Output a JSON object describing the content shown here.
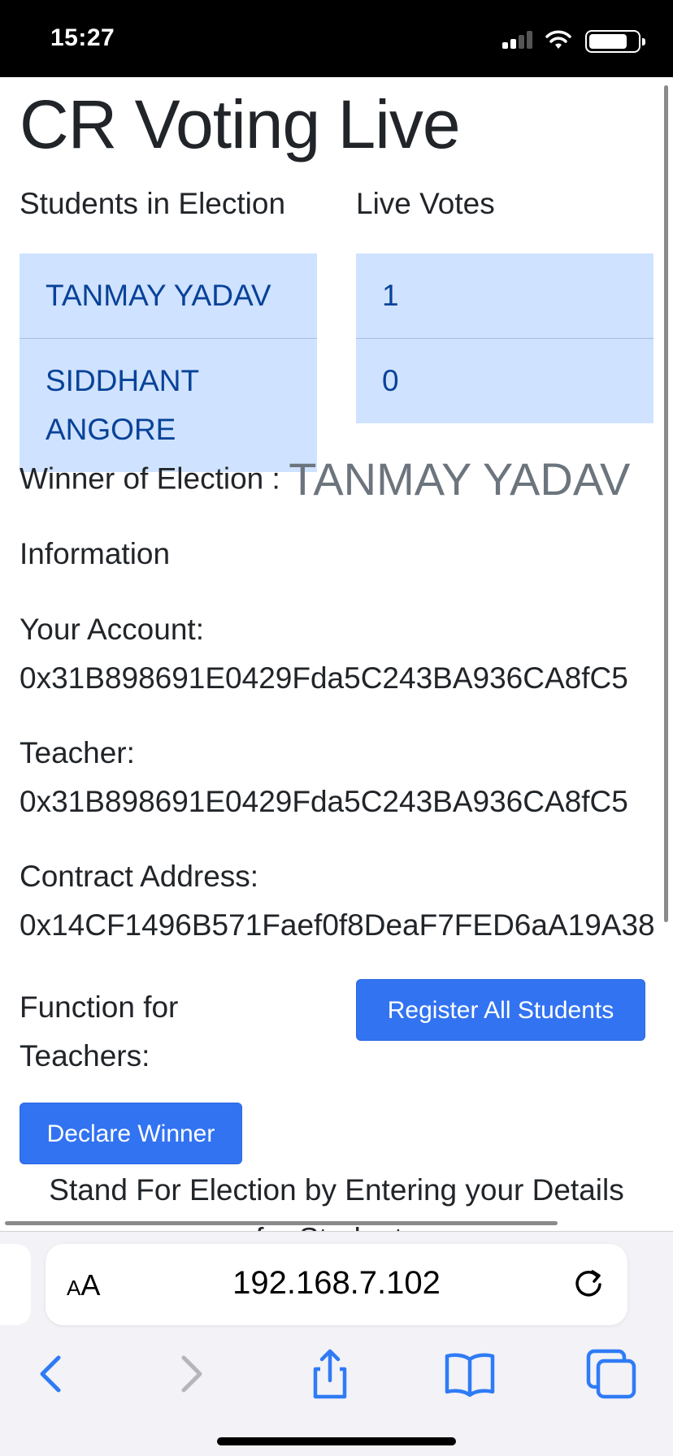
{
  "status_bar": {
    "time": "15:27"
  },
  "page": {
    "title": "CR Voting Live",
    "students_heading": "Students in Election",
    "votes_heading": "Live Votes",
    "students": [
      {
        "name": "TANMAY YADAV",
        "votes": "1"
      },
      {
        "name": "SIDDHANT ANGORE",
        "votes": "0"
      }
    ],
    "winner_label": "Winner of Election :",
    "winner_name": "TANMAY YADAV",
    "information_heading": "Information",
    "account_label": "Your Account:",
    "account_value": "0x31B898691E0429Fda5C243BA936CA8fC5",
    "teacher_label": "Teacher:",
    "teacher_value": "0x31B898691E0429Fda5C243BA936CA8fC5",
    "contract_label": "Contract Address:",
    "contract_value": "0x14CF1496B571Faef0f8DeaF7FED6aA19A38",
    "function_label": "Function for Teachers:",
    "register_button": "Register All Students",
    "declare_button": "Declare Winner",
    "stand_text": "Stand For Election by Entering your Details",
    "stand_text_partial": "for Students"
  },
  "browser": {
    "aa_label_big": "A",
    "aa_label_small": "A",
    "url": "192.168.7.102",
    "icons": [
      "reload-icon",
      "back-icon",
      "forward-icon",
      "share-icon",
      "bookmarks-icon",
      "tabs-icon"
    ]
  }
}
